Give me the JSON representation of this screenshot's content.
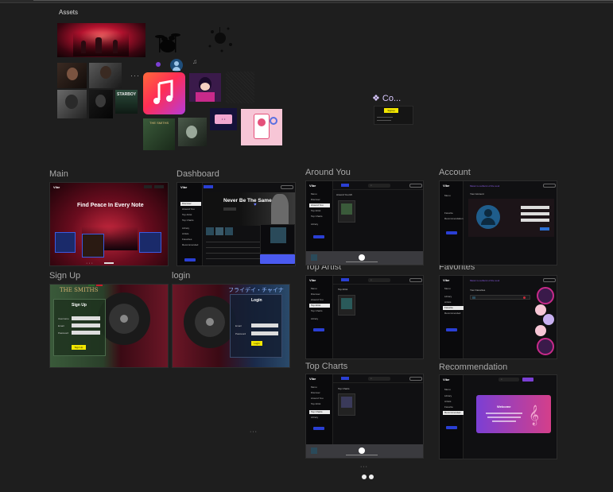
{
  "canvas": {
    "assets_label": "Assets",
    "component_label": "❖ Co...",
    "component_button": "Signup",
    "sections": {
      "main": "Main",
      "dashboard": "Dashboard",
      "around_you": "Around You",
      "account": "Account",
      "sign_up": "Sign Up",
      "login": "login",
      "top_artist": "Top Artist",
      "favorites": "Favorites",
      "top_charts": "Top Charts",
      "recommendation": "Recommendation"
    }
  },
  "frames": {
    "main": {
      "logo": "Vibe",
      "headline": "Find Peace In Every Note"
    },
    "dashboard": {
      "logo": "Vibe",
      "headline": "Never Be The Same",
      "sidebar_items": [
        "Discover",
        "Around You",
        "Top Artist",
        "Top Charts",
        "Library",
        "Artists",
        "Favorites",
        "Recommended"
      ]
    },
    "around_you": {
      "logo": "Vibe",
      "page_title": "Around You Mt",
      "sidebar_items": [
        "Menu",
        "Discover",
        "Around You",
        "Top Artist",
        "Top Charts",
        "Library"
      ]
    },
    "account": {
      "logo": "Vibe",
      "banner": "Music is outburst of the soul",
      "page_title": "Your Account",
      "sidebar_items": [
        "Menu",
        "Favorite",
        "Recommendation"
      ]
    },
    "sign_up": {
      "band": "THE SMITHS",
      "title": "Sign Up",
      "fields": [
        "Username",
        "Email",
        "Password"
      ],
      "button": "Sign Up"
    },
    "login": {
      "title": "Login",
      "fields": [
        "Email",
        "Password"
      ],
      "button": "Login"
    },
    "top_artist": {
      "logo": "Vibe",
      "page_title": "Top Artist",
      "sidebar_items": [
        "Menu",
        "Discover",
        "Around You",
        "Top Artist",
        "Top Charts",
        "Library"
      ]
    },
    "favorites": {
      "logo": "Vibe",
      "banner": "Music is outburst of the soul",
      "page_title": "Your Favorites",
      "sidebar_items": [
        "Menu",
        "Library",
        "Artists",
        "Favorite",
        "Recommended"
      ]
    },
    "top_charts": {
      "logo": "Vibe",
      "page_title": "Top Charts",
      "sidebar_items": [
        "Menu",
        "Discover",
        "Around You",
        "Top Artist",
        "Top Charts",
        "Library"
      ]
    },
    "recommendation": {
      "logo": "Vibe",
      "card_title": "Welcome",
      "sidebar_items": [
        "Menu",
        "Library",
        "Artists",
        "Favorite",
        "Recommended"
      ]
    }
  },
  "colors": {
    "canvas_bg": "#1e1e1e",
    "frame_bg": "#101012",
    "accent_blue": "#2a3fd4",
    "accent_yellow": "#f2e600",
    "accent_purple": "#7b3fd4"
  }
}
